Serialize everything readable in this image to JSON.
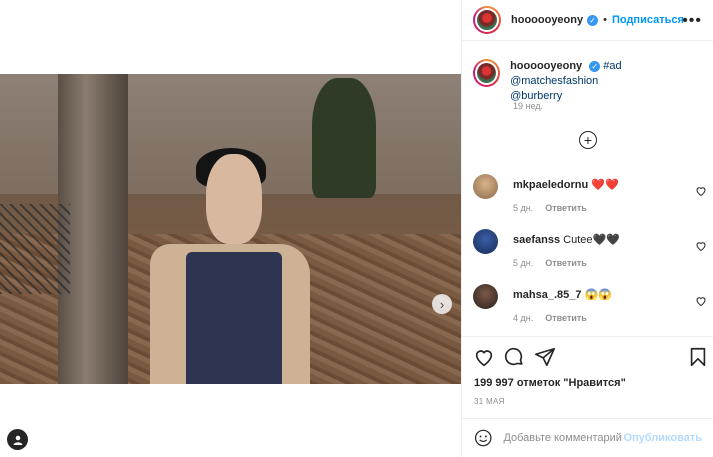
{
  "colors": {
    "accent": "#0095f6",
    "muted": "#8e8e8e",
    "heart": "#ed4956",
    "text": "#262626"
  },
  "header": {
    "username": "hoooooyeony",
    "verified_icon": "verified-badge-icon",
    "separator": "•",
    "follow_label": "Подписаться",
    "more_icon": "more-options-icon",
    "more_label": "•••"
  },
  "media": {
    "next_label": "›",
    "user_tag_icon": "user-tag-icon"
  },
  "caption": {
    "username": "hoooooyeony",
    "tags": [
      "#ad",
      "@matchesfashion",
      "@burberry"
    ],
    "time": "19 нед."
  },
  "load_more_label": "+",
  "comments": [
    {
      "username": "mkpaeledornu",
      "text": "❤️❤️",
      "time": "5 дн.",
      "reply_label": "Ответить"
    },
    {
      "username": "saefanss",
      "text": "Cutee🖤🖤",
      "time": "5 дн.",
      "reply_label": "Ответить"
    },
    {
      "username": "mahsa_.85_7",
      "text": "😱😱",
      "time": "4 дн.",
      "reply_label": "Ответить"
    }
  ],
  "actions": {
    "icons": [
      "heart-icon",
      "comment-icon",
      "share-icon",
      "bookmark-icon"
    ]
  },
  "likes": "199 997 отметок \"Нравится\"",
  "date": "31 МАЯ",
  "add_comment": {
    "placeholder": "Добавьте комментарий...",
    "publish_label": "Опубликовать"
  }
}
